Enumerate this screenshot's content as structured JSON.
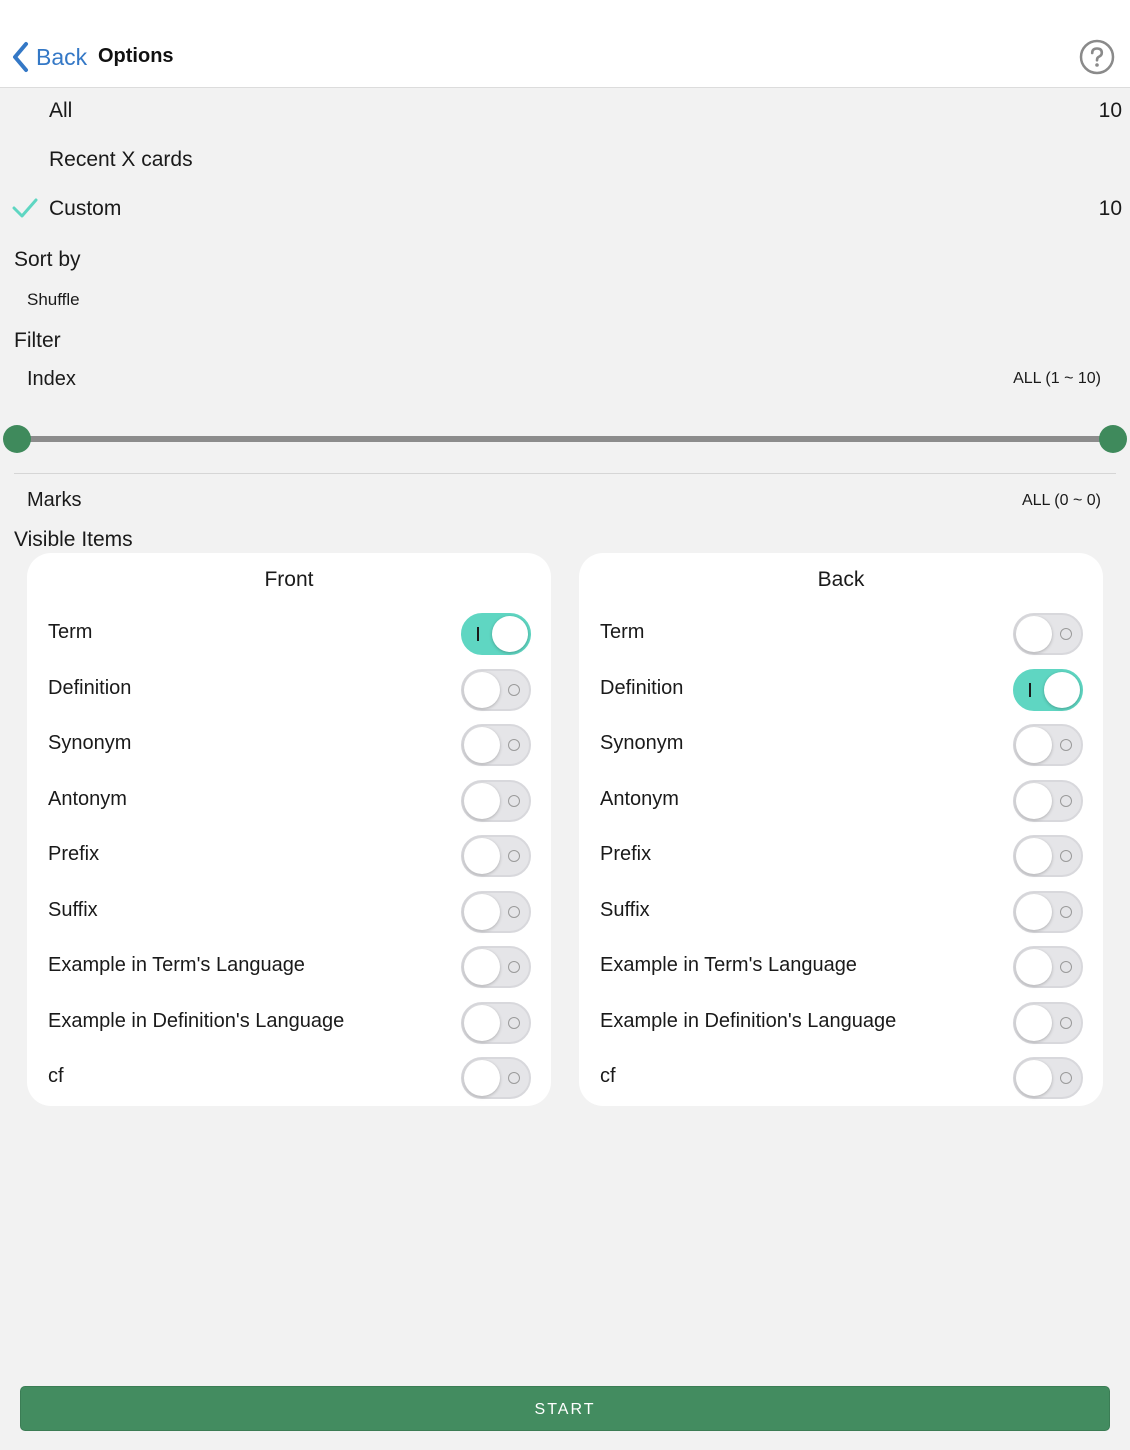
{
  "nav": {
    "back_label": "Back",
    "title": "Options"
  },
  "range": {
    "all": {
      "label": "All",
      "count": "10"
    },
    "recent": {
      "label": "Recent X cards"
    },
    "custom": {
      "label": "Custom",
      "count": "10",
      "selected": true
    }
  },
  "sort": {
    "title": "Sort by",
    "value": "Shuffle"
  },
  "filter": {
    "title": "Filter",
    "index": {
      "label": "Index",
      "range": "ALL (1 ~ 10)",
      "min": 1,
      "max": 10,
      "low": 1,
      "high": 10
    },
    "marks": {
      "label": "Marks",
      "range": "ALL (0 ~ 0)"
    }
  },
  "visible_items": {
    "title": "Visible Items",
    "front": {
      "title": "Front",
      "items": [
        {
          "label": "Term",
          "on": true
        },
        {
          "label": "Definition",
          "on": false
        },
        {
          "label": "Synonym",
          "on": false
        },
        {
          "label": "Antonym",
          "on": false
        },
        {
          "label": "Prefix",
          "on": false
        },
        {
          "label": "Suffix",
          "on": false
        },
        {
          "label": "Example in Term's Language",
          "on": false
        },
        {
          "label": "Example in Definition's Language",
          "on": false
        },
        {
          "label": "cf",
          "on": false
        }
      ]
    },
    "back": {
      "title": "Back",
      "items": [
        {
          "label": "Term",
          "on": false
        },
        {
          "label": "Definition",
          "on": true
        },
        {
          "label": "Synonym",
          "on": false
        },
        {
          "label": "Antonym",
          "on": false
        },
        {
          "label": "Prefix",
          "on": false
        },
        {
          "label": "Suffix",
          "on": false
        },
        {
          "label": "Example in Term's Language",
          "on": false
        },
        {
          "label": "Example in Definition's Language",
          "on": false
        },
        {
          "label": "cf",
          "on": false
        }
      ]
    }
  },
  "start_label": "START",
  "colors": {
    "accent": "#3478c6",
    "toggle_on": "#5fd6c2",
    "slider": "#3f8a5c",
    "start": "#438c60",
    "check": "#5fd6c2"
  },
  "icons": {
    "back": "chevron-left-icon",
    "help": "help-circle-icon",
    "selected": "checkmark-icon"
  }
}
